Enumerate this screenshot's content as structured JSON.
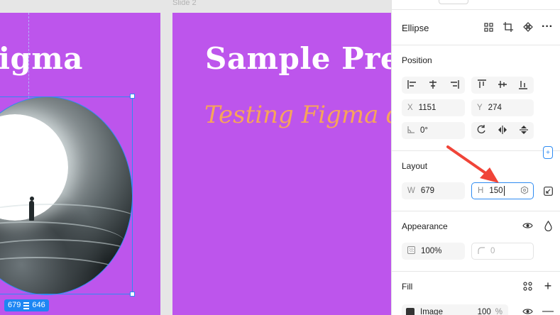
{
  "canvas": {
    "slide_label": "Slide 2",
    "slide1_heading": "igma",
    "slide2_heading": "Sample Pres",
    "slide2_subheading": "Testing Figma d",
    "size_badge": {
      "width": "679",
      "height": "646"
    }
  },
  "panel": {
    "title": "Ellipse",
    "position": {
      "title": "Position",
      "x_label": "X",
      "x_value": "1151",
      "y_label": "Y",
      "y_value": "274",
      "rotation_value": "0°"
    },
    "layout": {
      "title": "Layout",
      "w_label": "W",
      "w_value": "679",
      "h_label": "H",
      "h_value": "150"
    },
    "appearance": {
      "title": "Appearance",
      "opacity_value": "100%",
      "radius_value": "0"
    },
    "fill": {
      "title": "Fill",
      "type_label": "Image",
      "opacity_value": "100",
      "opacity_unit": "%"
    }
  },
  "colors": {
    "slide_bg": "#bd55ec",
    "accent": "#2e8bf2",
    "subheading": "#f7a45a",
    "annotation_arrow": "#f04438"
  },
  "icons": [
    "grid-icon",
    "crop-icon",
    "component-icon",
    "more-icon",
    "align-left-icon",
    "align-center-h-icon",
    "align-right-icon",
    "align-top-icon",
    "align-middle-v-icon",
    "align-bottom-icon",
    "rotation-icon",
    "rotate-icon",
    "flip-h-icon",
    "flip-v-icon",
    "constraints-icon",
    "resize-icon",
    "eye-icon",
    "drop-icon",
    "opacity-icon",
    "corner-radius-icon",
    "styles-icon",
    "plus-icon",
    "minus-icon",
    "image-swatch-icon"
  ]
}
